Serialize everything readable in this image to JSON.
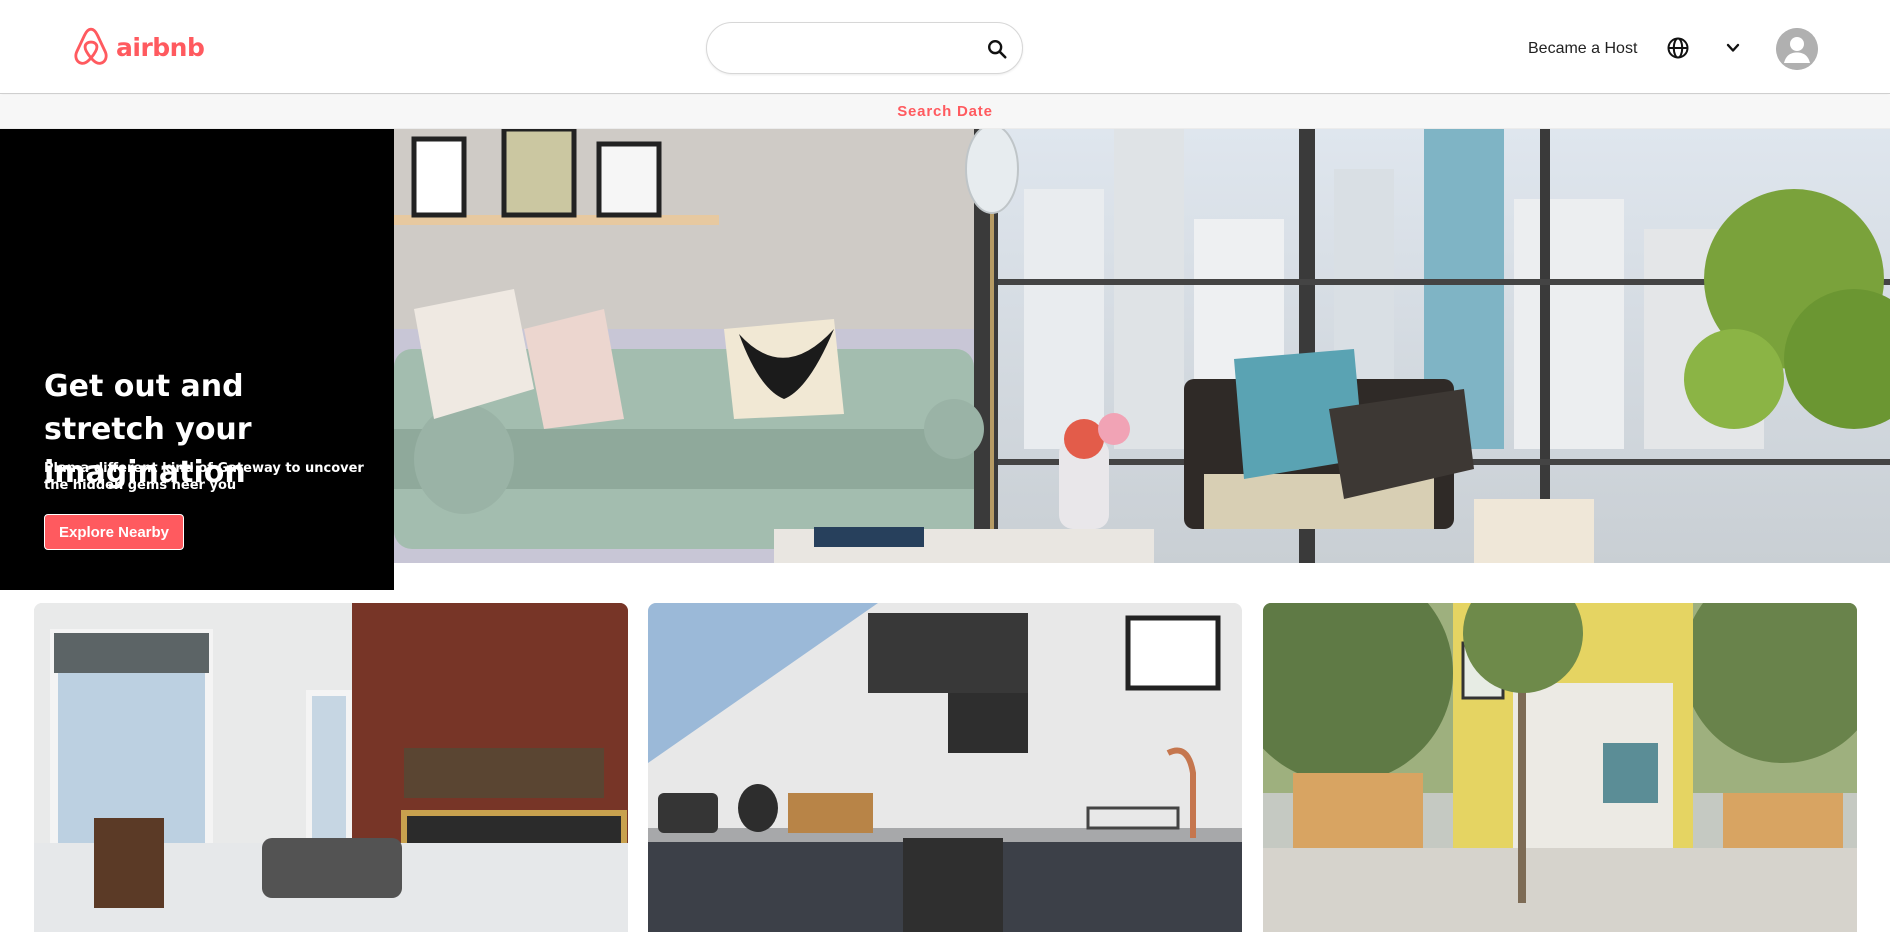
{
  "header": {
    "logo_text": "airbnb",
    "search": {
      "value": "",
      "placeholder": ""
    },
    "host_link": "Became a Host"
  },
  "subbar": {
    "search_date": "Search Date"
  },
  "hero": {
    "title": "Get out and stretch your imagination",
    "subtitle": "Plan a different kind of Gateway to uncover the hidden gems neer you",
    "button": "Explore Nearby"
  },
  "colors": {
    "brand": "#ff5a5f",
    "hero_panel": "#000000"
  },
  "icons": [
    "airbnb-logo-icon",
    "search-icon",
    "globe-icon",
    "chevron-down-icon",
    "user-avatar-icon"
  ]
}
